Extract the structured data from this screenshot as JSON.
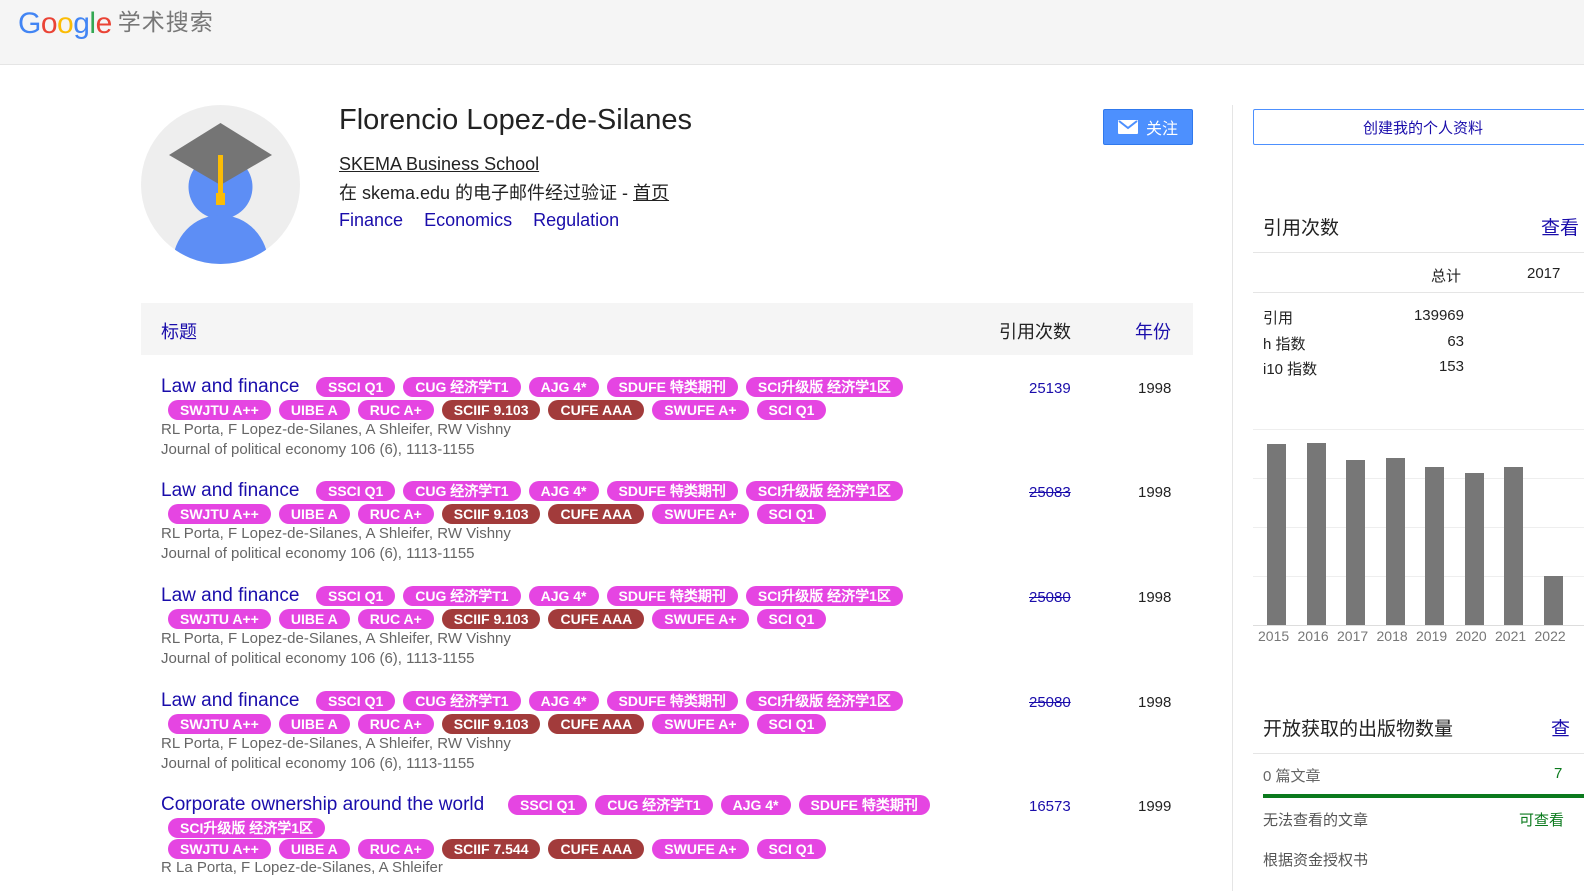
{
  "header": {
    "logo_word": "Google",
    "logo_sub": "学术搜索"
  },
  "profile": {
    "name": "Florencio Lopez-de-Silanes",
    "affiliation": "SKEMA Business School",
    "email_text": "在 skema.edu 的电子邮件经过验证 - ",
    "homepage_label": "首页",
    "interests": [
      "Finance",
      "Economics",
      "Regulation"
    ],
    "follow_label": "关注"
  },
  "table": {
    "title_header": "标题",
    "cited_header": "引用次数",
    "year_header": "年份"
  },
  "articles": [
    {
      "title": "Law and finance",
      "authors": "RL Porta, F Lopez-de-Silanes, A Shleifer, RW Vishny",
      "venue": "Journal of political economy 106 (6), 1113-1155",
      "cited": "25139",
      "year": "1998"
    },
    {
      "title": "Law and finance",
      "authors": "RL Porta, F Lopez-de-Silanes, A Shleifer, RW Vishny",
      "venue": "Journal of political economy 106 (6), 1113-1155",
      "cited": "25083",
      "year": "1998"
    },
    {
      "title": "Law and finance",
      "authors": "RL Porta, F Lopez-de-Silanes, A Shleifer, RW Vishny",
      "venue": "Journal of political economy 106 (6), 1113-1155",
      "cited": "25080",
      "year": "1998"
    },
    {
      "title": "Law and finance",
      "authors": "RL Porta, F Lopez-de-Silanes, A Shleifer, RW Vishny",
      "venue": "Journal of political economy 106 (6), 1113-1155",
      "cited": "25080",
      "year": "1998"
    },
    {
      "title": "Corporate ownership around the world",
      "authors": "R La Porta, F Lopez-de-Silanes, A Shleifer",
      "cited": "16573",
      "year": "1999"
    }
  ],
  "badges_row1": [
    "SSCI Q1",
    "CUG 经济学T1",
    "AJG 4*",
    "SDUFE 特类期刊",
    "SCI升级版 经济学1区"
  ],
  "badges_row2": [
    "SWJTU A++",
    "UIBE A",
    "RUC A+",
    "SCIIF 9.103",
    "CUFE AAA",
    "SWUFE A+",
    "SCI Q1"
  ],
  "badges_row2_last": [
    "SWJTU A++",
    "UIBE A",
    "RUC A+",
    "SCIIF 7.544",
    "CUFE AAA",
    "SWUFE A+",
    "SCI Q1"
  ],
  "sidebar": {
    "create_label": "创建我的个人资料",
    "cited_title": "引用次数",
    "cited_view": "查看",
    "col_total": "总计",
    "col_since": "2017",
    "stats": [
      {
        "label": "引用",
        "value": "139969"
      },
      {
        "label": "h 指数",
        "value": "63"
      },
      {
        "label": "i10 指数",
        "value": "153"
      }
    ],
    "years": [
      "2015",
      "2016",
      "2017",
      "2018",
      "2019",
      "2020",
      "2021",
      "2022"
    ],
    "oa_title": "开放获取的出版物数量",
    "oa_view": "查",
    "oa_count_left": "0 篇文章",
    "oa_count_right": "7",
    "oa_unavailable": "无法查看的文章",
    "oa_available": "可查看",
    "oa_funding": "根据资金授权书"
  },
  "chart_data": {
    "type": "bar",
    "categories": [
      "2015",
      "2016",
      "2017",
      "2018",
      "2019",
      "2020",
      "2021",
      "2022"
    ],
    "values": [
      0.95,
      0.96,
      0.87,
      0.88,
      0.83,
      0.8,
      0.83,
      0.26
    ],
    "ylabel": "",
    "grid": true
  },
  "colors": {
    "link": "#1a0dab",
    "badge_pink": "#e545e2",
    "badge_dark": "#a23b3b",
    "bar": "#777777",
    "oa_green": "#0b7a1d"
  }
}
